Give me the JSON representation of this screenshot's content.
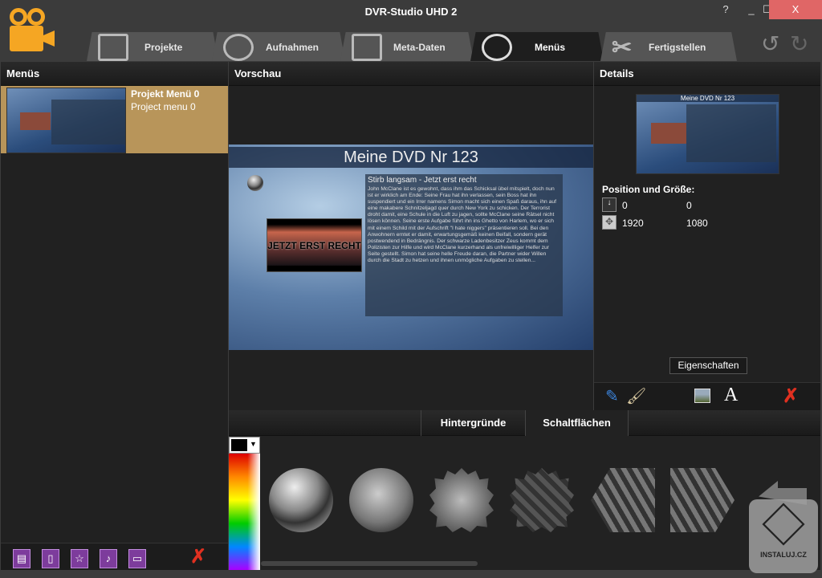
{
  "window": {
    "title": "DVR-Studio UHD 2",
    "help": "?",
    "minimize": "_",
    "maximize": "☐",
    "close": "X"
  },
  "tabs": [
    {
      "label": "Projekte"
    },
    {
      "label": "Aufnahmen"
    },
    {
      "label": "Meta-Daten"
    },
    {
      "label": "Menüs"
    },
    {
      "label": "Fertigstellen"
    }
  ],
  "undo": "↺",
  "redo": "↻",
  "left": {
    "header": "Menüs",
    "items": [
      {
        "title": "Projekt Menü 0",
        "subtitle": "Project menu 0"
      }
    ]
  },
  "preview": {
    "header": "Vorschau",
    "menu_title": "Meine DVD Nr 123",
    "movie_title": "Stirb langsam - Jetzt erst recht",
    "film_label": "JETZT ERST RECHT",
    "description": "John McClane ist es gewohnt, dass ihm das Schicksal übel mitspielt, doch nun ist er wirklich am Ende: Seine Frau hat ihn verlassen, sein Boss hat ihn suspendiert und ein Irrer namens Simon macht sich einen Spaß daraus, ihn auf eine makabere Schnitzeljagd quer durch New York zu schicken. Der Terrorist droht damit, eine Schule in die Luft zu jagen, sollte McClane seine Rätsel nicht lösen können. Seine erste Aufgabe führt ihn ins Ghetto von Harlem, wo er sich mit einem Schild mit der Aufschrift \"I hate niggers\" präsentieren soll. Bei den Anwohnern erntet er damit, erwartungsgemäß keinen Beifall, sondern gerät postwendend in Bedrängnis. Der schwarze Ladenbesitzer Zeus kommt dem Polizisten zur Hilfe und wird McClane kurzerhand als unfreiwilliger Helfer zur Seite gestellt. Simon hat seine helle Freude daran, die Partner wider Willen durch die Stadt zu hetzen und ihnen unmögliche Aufgaben zu stellen..."
  },
  "details": {
    "header": "Details",
    "thumb_title": "Meine DVD Nr 123",
    "pos_label": "Position und Größe:",
    "x": "0",
    "y": "0",
    "width": "1920",
    "height": "1080",
    "properties_button": "Eigenschaften",
    "text_tool": "A",
    "delete": "✗"
  },
  "bottom": {
    "tabs": [
      {
        "label": "Hintergründe"
      },
      {
        "label": "Schaltflächen"
      }
    ],
    "active_tab": "Schaltflächen",
    "color": "#000000"
  },
  "left_toolbar": {
    "delete": "✗"
  },
  "watermark": "INSTALUJ.CZ"
}
